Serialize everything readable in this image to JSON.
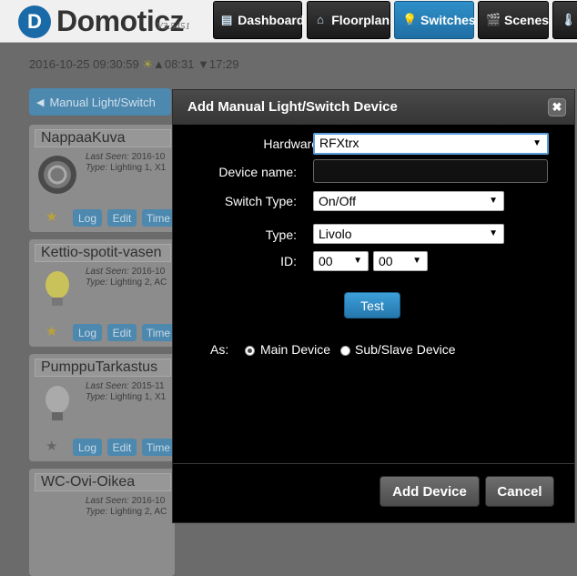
{
  "header": {
    "logo_letter": "D",
    "logo_text": "Domoticz",
    "version": "V3.5451",
    "nav": [
      {
        "label": "Dashboard",
        "icon": "dashboard-icon",
        "glyph": "▤"
      },
      {
        "label": "Floorplan",
        "icon": "house-icon",
        "glyph": "⌂"
      },
      {
        "label": "Switches",
        "icon": "lightbulb-icon",
        "glyph": "💡"
      },
      {
        "label": "Scenes",
        "icon": "clapperboard-icon",
        "glyph": "🎬"
      },
      {
        "label": "",
        "icon": "thermometer-icon",
        "glyph": "🌡"
      }
    ]
  },
  "status": {
    "datetime": "2016-10-25 09:30:59",
    "sun_icon": "☀",
    "sunrise": "▲08:31",
    "sunset": "▼17:29"
  },
  "back_button": {
    "icon": "◀",
    "label": "Manual Light/Switch"
  },
  "devices": [
    {
      "name": "NappaaKuva",
      "last_seen_label": "Last Seen:",
      "last_seen": "2016-10",
      "type_label": "Type:",
      "type": "Lighting 1, X1"
    },
    {
      "name": "Kettio-spotit-vasen",
      "last_seen_label": "Last Seen:",
      "last_seen": "2016-10",
      "type_label": "Type:",
      "type": "Lighting 2, AC"
    },
    {
      "name": "PumppuTarkastus",
      "last_seen_label": "Last Seen:",
      "last_seen": "2015-11",
      "type_label": "Type:",
      "type": "Lighting 1, X1"
    },
    {
      "name": "WC-Ovi-Oikea",
      "last_seen_label": "Last Seen:",
      "last_seen": "2016-10",
      "type_label": "Type:",
      "type": "Lighting 2, AC"
    }
  ],
  "card_buttons": {
    "log": "Log",
    "edit": "Edit",
    "timers": "Time"
  },
  "dialog": {
    "title": "Add Manual Light/Switch Device",
    "close_glyph": "✖",
    "hardware_label": "Hardware:",
    "hardware_value": "RFXtrx",
    "device_name_label": "Device name:",
    "device_name_value": "",
    "switch_type_label": "Switch Type:",
    "switch_type_value": "On/Off",
    "type_label": "Type:",
    "type_value": "Livolo",
    "id_label": "ID:",
    "id1_value": "00",
    "id2_value": "00",
    "test_label": "Test",
    "as_label": "As:",
    "main_device_label": "Main Device",
    "sub_device_label": "Sub/Slave Device",
    "main_selected": true,
    "add_label": "Add Device",
    "cancel_label": "Cancel",
    "arrow_glyph": "▼"
  }
}
